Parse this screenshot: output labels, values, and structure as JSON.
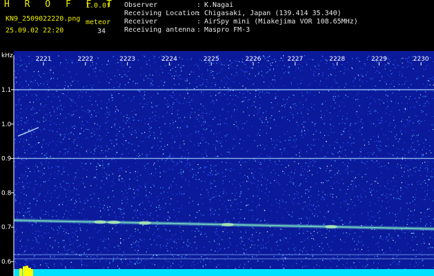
{
  "header": {
    "app_title": "H R O F F T",
    "version": "1.0.0f",
    "filename": "KN9_2509022220.png",
    "datetime": "25.09.02 22:20",
    "meteor_label": "meteor",
    "meteor_count": "34",
    "info": [
      {
        "label": "Observer",
        "sep": ":",
        "value": "K.Nagai"
      },
      {
        "label": "Receiving Location",
        "sep": ":",
        "value": "Chigasaki, Japan (139.414 35.340)"
      },
      {
        "label": "Receiver",
        "sep": ":",
        "value": "AirSpy mini (Miakejima VOR 108.65MHz)"
      },
      {
        "label": "Receiving antenna",
        "sep": ":",
        "value": "Maspro FM-3"
      }
    ]
  },
  "spectrogram": {
    "y_unit": "kHz",
    "y_ticks": [
      "1.1",
      "1.0",
      "0.9",
      "0.8",
      "0.7",
      "0.6"
    ],
    "y_range": [
      0.58,
      1.17
    ],
    "x_ticks": [
      "2221",
      "2222",
      "2223",
      "2224",
      "2225",
      "2226",
      "2227",
      "2228",
      "2229",
      "2230"
    ],
    "colors": {
      "background": "#0b1a9a",
      "noise": [
        "#2a4cff",
        "#3aa0ff",
        "#8fe0ff",
        "#ffffff"
      ],
      "carrier": "#9fd0ff",
      "meteor_band": "#7fe8c8",
      "bottom_bar": "#00e0ff",
      "bottom_peaks": "#ffff00"
    },
    "carrier_lines_khz": [
      1.1,
      0.9,
      0.62,
      0.608
    ],
    "meteor_trace": {
      "start_khz": 0.72,
      "end_khz": 0.695
    }
  }
}
